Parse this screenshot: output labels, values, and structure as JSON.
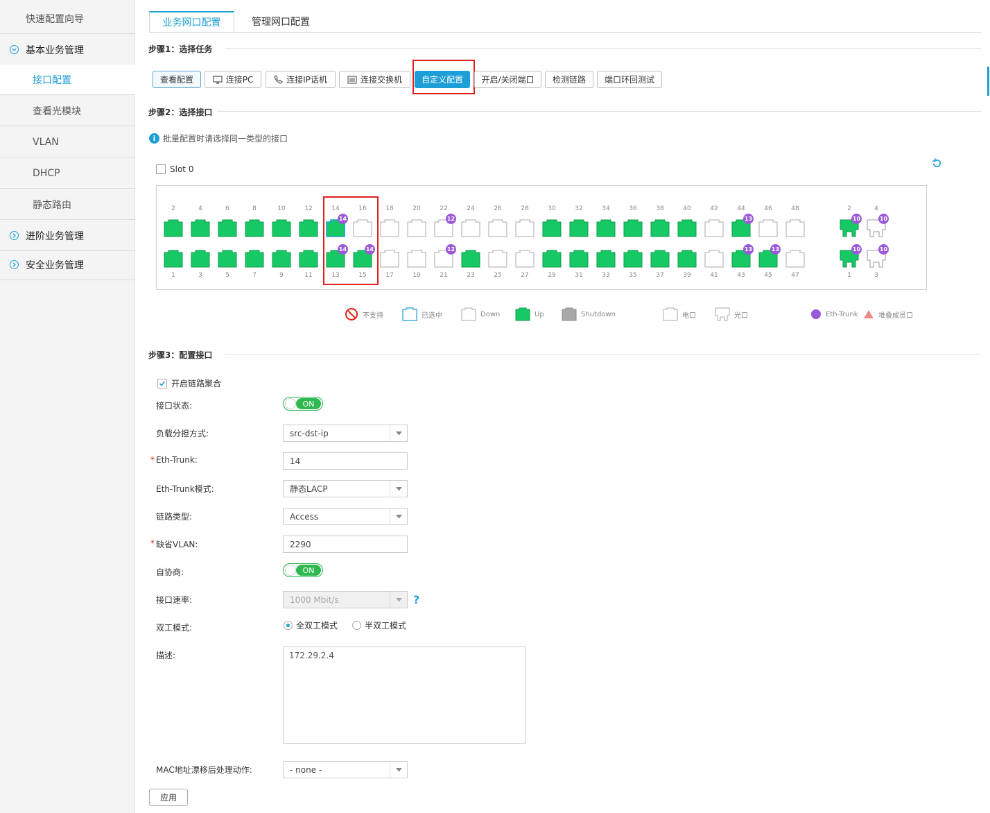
{
  "sidebar": {
    "top_item": "快速配置向导",
    "groups": [
      {
        "label": "基本业务管理",
        "items": [
          "接口配置",
          "查看光模块",
          "VLAN",
          "DHCP",
          "静态路由"
        ]
      },
      {
        "label": "进阶业务管理"
      },
      {
        "label": "安全业务管理"
      }
    ],
    "active": "接口配置"
  },
  "tabs": [
    "业务网口配置",
    "管理网口配置"
  ],
  "step1": {
    "title": "步骤1：选择任务",
    "buttons": [
      "查看配置",
      "连接PC",
      "连接IP话机",
      "连接交换机",
      "自定义配置",
      "开启/关闭端口",
      "检测链路",
      "端口环回测试"
    ]
  },
  "step2": {
    "title": "步骤2：选择接口",
    "info": "批量配置时请选择同一类型的接口",
    "slot_label": "Slot 0"
  },
  "ports": {
    "top_row": [
      {
        "n": "2",
        "s": "up"
      },
      {
        "n": "4",
        "s": "up"
      },
      {
        "n": "6",
        "s": "up"
      },
      {
        "n": "8",
        "s": "up"
      },
      {
        "n": "10",
        "s": "up"
      },
      {
        "n": "12",
        "s": "up"
      },
      {
        "n": "14",
        "s": "up",
        "badge": "14",
        "selected": true
      },
      {
        "n": "16",
        "s": "down"
      },
      {
        "n": "18",
        "s": "down"
      },
      {
        "n": "20",
        "s": "down"
      },
      {
        "n": "22",
        "s": "down",
        "badge": "12"
      },
      {
        "n": "24",
        "s": "down"
      },
      {
        "n": "26",
        "s": "down"
      },
      {
        "n": "28",
        "s": "down"
      },
      {
        "n": "30",
        "s": "up"
      },
      {
        "n": "32",
        "s": "up"
      },
      {
        "n": "34",
        "s": "up"
      },
      {
        "n": "36",
        "s": "up"
      },
      {
        "n": "38",
        "s": "up"
      },
      {
        "n": "40",
        "s": "up"
      },
      {
        "n": "42",
        "s": "down"
      },
      {
        "n": "44",
        "s": "up",
        "badge": "13"
      },
      {
        "n": "46",
        "s": "down"
      },
      {
        "n": "48",
        "s": "down"
      }
    ],
    "bottom_row": [
      {
        "n": "1",
        "s": "up"
      },
      {
        "n": "3",
        "s": "up"
      },
      {
        "n": "5",
        "s": "up"
      },
      {
        "n": "7",
        "s": "up"
      },
      {
        "n": "9",
        "s": "up"
      },
      {
        "n": "11",
        "s": "up"
      },
      {
        "n": "13",
        "s": "up",
        "badge": "14"
      },
      {
        "n": "15",
        "s": "up",
        "badge": "14"
      },
      {
        "n": "17",
        "s": "down"
      },
      {
        "n": "19",
        "s": "down"
      },
      {
        "n": "21",
        "s": "down",
        "badge": "12"
      },
      {
        "n": "23",
        "s": "up"
      },
      {
        "n": "25",
        "s": "down"
      },
      {
        "n": "27",
        "s": "down"
      },
      {
        "n": "29",
        "s": "up"
      },
      {
        "n": "31",
        "s": "up"
      },
      {
        "n": "33",
        "s": "up"
      },
      {
        "n": "35",
        "s": "up"
      },
      {
        "n": "37",
        "s": "up"
      },
      {
        "n": "39",
        "s": "up"
      },
      {
        "n": "41",
        "s": "down"
      },
      {
        "n": "43",
        "s": "up",
        "badge": "13"
      },
      {
        "n": "45",
        "s": "up",
        "badge": "13"
      },
      {
        "n": "47",
        "s": "down"
      }
    ],
    "sfp_top": [
      {
        "n": "2",
        "s": "up",
        "badge": "10"
      },
      {
        "n": "4",
        "s": "down",
        "badge": "10"
      }
    ],
    "sfp_bottom": [
      {
        "n": "1",
        "s": "up",
        "badge": "10"
      },
      {
        "n": "3",
        "s": "down",
        "badge": "10"
      }
    ]
  },
  "legend": [
    "不支持",
    "已选中",
    "Down",
    "Up",
    "Shutdown",
    "电口",
    "光口",
    "Eth-Trunk",
    "堆叠成员口"
  ],
  "step3": {
    "title": "步骤3：配置接口",
    "link_aggregation": "开启链路聚合",
    "fields": {
      "port_status": {
        "label": "接口状态:",
        "value": "ON"
      },
      "load_balance": {
        "label": "负载分担方式:",
        "value": "src-dst-ip"
      },
      "eth_trunk": {
        "label": "Eth-Trunk:",
        "value": "14"
      },
      "eth_trunk_mode": {
        "label": "Eth-Trunk模式:",
        "value": "静态LACP"
      },
      "link_type": {
        "label": "链路类型:",
        "value": "Access"
      },
      "default_vlan": {
        "label": "缺省VLAN:",
        "value": "2290"
      },
      "auto_neg": {
        "label": "自协商:",
        "value": "ON"
      },
      "speed": {
        "label": "接口速率:",
        "value": "1000 Mbit/s"
      },
      "duplex": {
        "label": "双工模式:",
        "options": [
          "全双工模式",
          "半双工模式"
        ]
      },
      "description": {
        "label": "描述:",
        "value": "172.29.2.4"
      },
      "mac_action": {
        "label": "MAC地址漂移后处理动作:",
        "value": "- none -"
      }
    },
    "apply": "应用"
  },
  "colors": {
    "accent": "#1e9ed6",
    "up": "#17c964",
    "trunk": "#9b59d9",
    "highlight": "#e0201c"
  }
}
